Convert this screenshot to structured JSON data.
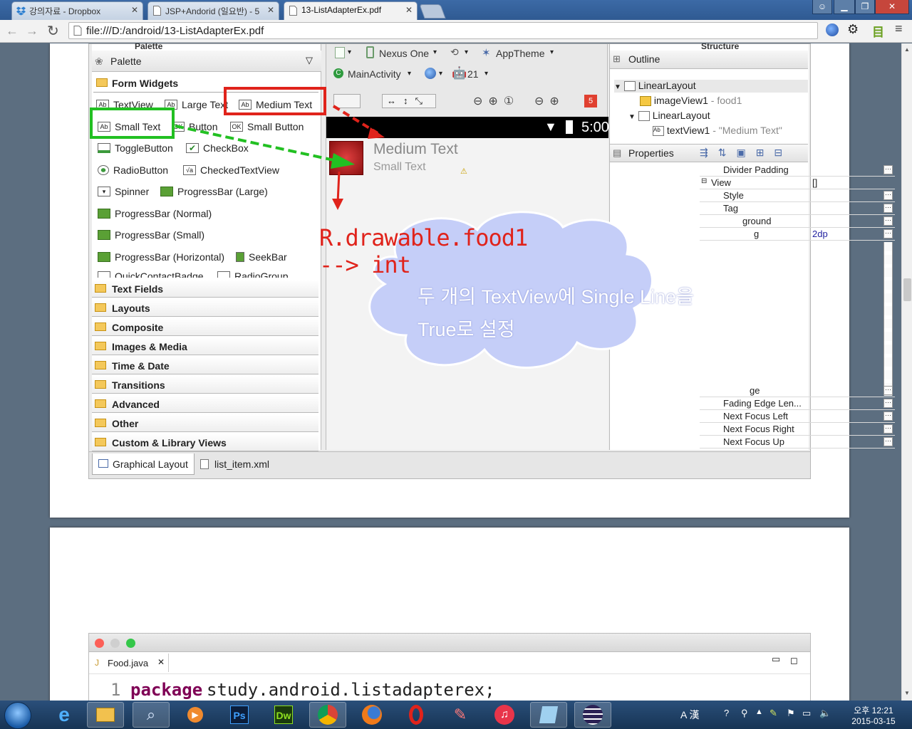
{
  "browser": {
    "tabs": [
      {
        "title": "강의자료 - Dropbox",
        "icon": "dropbox-icon"
      },
      {
        "title": "JSP+Andorid (일요반) - 5",
        "icon": "page-icon"
      },
      {
        "title": "13-ListAdapterEx.pdf",
        "icon": "page-icon"
      }
    ],
    "url": "file:///D:/android/13-ListAdapterEx.pdf"
  },
  "eclipse": {
    "palette": {
      "header": "Palette",
      "title": "Palette",
      "section": "Form Widgets",
      "widgets": [
        "TextView",
        "Large Text",
        "Medium Text",
        "Small Text",
        "Button",
        "Small Button",
        "ToggleButton",
        "CheckBox",
        "RadioButton",
        "CheckedTextView",
        "Spinner",
        "ProgressBar (Large)",
        "ProgressBar (Normal)",
        "ProgressBar (Small)",
        "ProgressBar (Horizontal)",
        "SeekBar",
        "QuickContactBadge",
        "RadioGroup"
      ],
      "categories": [
        "Text Fields",
        "Layouts",
        "Composite",
        "Images & Media",
        "Time & Date",
        "Transitions",
        "Advanced",
        "Other",
        "Custom & Library Views"
      ]
    },
    "canvas_toolbar": {
      "device": "Nexus One",
      "theme": "AppTheme",
      "activity": "MainActivity",
      "api": "21",
      "badge": "5"
    },
    "phone": {
      "time": "5:00",
      "medium_text": "Medium Text",
      "small_text": "Small Text"
    },
    "structure": {
      "header": "Structure",
      "outline_title": "Outline",
      "tree": [
        {
          "name": "LinearLayout",
          "detail": ""
        },
        {
          "name": "imageView1",
          "detail": " - food1"
        },
        {
          "name": "LinearLayout",
          "detail": ""
        },
        {
          "name": "textView1",
          "detail": " - \"Medium Text\""
        }
      ],
      "properties_title": "Properties",
      "properties": [
        {
          "name": "Divider Padding",
          "value": ""
        },
        {
          "name": "View",
          "value": "[]"
        },
        {
          "name": "Style",
          "value": ""
        },
        {
          "name": "Tag",
          "value": ""
        },
        {
          "name": "ground",
          "value": ""
        },
        {
          "name": "g",
          "value": "2dp"
        },
        {
          "name": "ge",
          "value": ""
        },
        {
          "name": "Fading Edge Len...",
          "value": ""
        },
        {
          "name": "Next Focus Left",
          "value": ""
        },
        {
          "name": "Next Focus Right",
          "value": ""
        },
        {
          "name": "Next Focus Up",
          "value": ""
        }
      ]
    },
    "bottom_tabs": [
      "Graphical Layout",
      "list_item.xml"
    ]
  },
  "annotations": {
    "drawable_line1": "R.drawable.food1",
    "drawable_line2": "--> int",
    "cloud_line1": "두 개의 TextView에 Single Line을",
    "cloud_line2": "True로 설정"
  },
  "code_window": {
    "tab": "Food.java",
    "line_number": "1",
    "keyword": "package",
    "code": " study.android.listadapterex;"
  },
  "taskbar": {
    "time": "오후 12:21",
    "date": "2015-03-15",
    "ime": "A 漢",
    "apps": [
      "ie-icon",
      "explorer-icon",
      "search-icon",
      "media-icon",
      "photoshop-icon",
      "dreamweaver-icon",
      "chrome-icon",
      "firefox-icon",
      "opera-icon",
      "paint-icon",
      "itunes-icon",
      "notepad-icon",
      "eclipse-icon"
    ],
    "app_labels": {
      "photoshop": "Ps",
      "dreamweaver": "Dw"
    }
  },
  "colors": {
    "red_annotation": "#e0231b",
    "green_annotation": "#22c022",
    "cloud_fill": "#c5cef8"
  }
}
